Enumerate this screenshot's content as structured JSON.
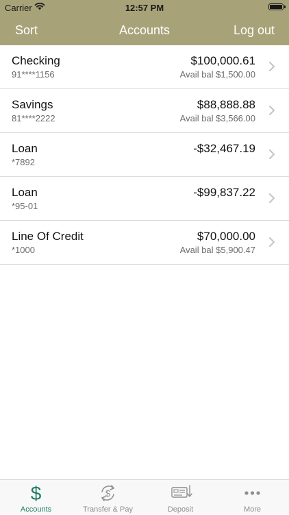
{
  "status_bar": {
    "carrier": "Carrier",
    "time": "12:57 PM"
  },
  "nav": {
    "left_label": "Sort",
    "title": "Accounts",
    "right_label": "Log out"
  },
  "accounts": [
    {
      "name": "Checking",
      "number": "91****1156",
      "balance": "$100,000.61",
      "available": "Avail bal $1,500.00"
    },
    {
      "name": "Savings",
      "number": "81****2222",
      "balance": "$88,888.88",
      "available": "Avail bal $3,566.00"
    },
    {
      "name": "Loan",
      "number": "*7892",
      "balance": "-$32,467.19",
      "available": ""
    },
    {
      "name": "Loan",
      "number": "*95-01",
      "balance": "-$99,837.22",
      "available": ""
    },
    {
      "name": "Line Of Credit",
      "number": "*1000",
      "balance": "$70,000.00",
      "available": "Avail bal $5,900.47"
    }
  ],
  "tab_bar": {
    "items": [
      {
        "label": "Accounts",
        "icon": "dollar-icon",
        "active": true
      },
      {
        "label": "Transfer & Pay",
        "icon": "transfer-icon",
        "active": false
      },
      {
        "label": "Deposit",
        "icon": "deposit-check-icon",
        "active": false
      },
      {
        "label": "More",
        "icon": "more-icon",
        "active": false
      }
    ]
  },
  "colors": {
    "header": "#a8a279",
    "accent": "#1f7b63",
    "inactive_tab": "#8e8e8e",
    "divider": "#dcdcdc"
  }
}
